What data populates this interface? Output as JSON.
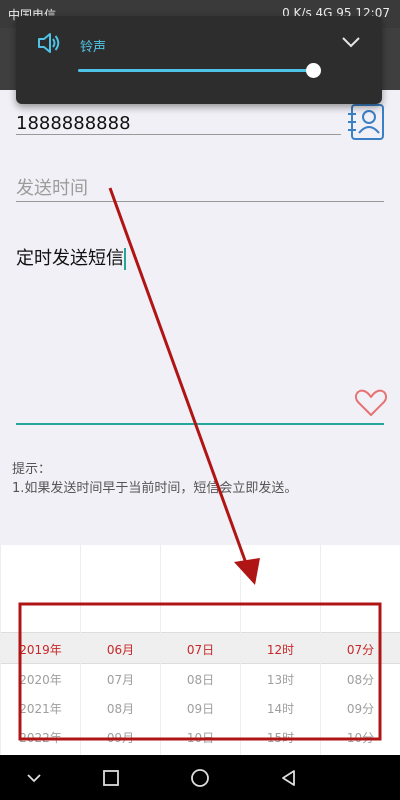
{
  "status_bar": {
    "carrier": "中国电信",
    "speed": "0 K/s",
    "network": "4G",
    "battery": "95",
    "time": "12:07"
  },
  "volume_popup": {
    "label": "铃声",
    "level": 0.97,
    "accent_color": "#4fc3e6"
  },
  "form": {
    "phone_value": "1888888888",
    "send_time_placeholder": "发送时间",
    "message_value": "定时发送短信"
  },
  "tips": {
    "title": "提示：",
    "line1": "1.如果发送时间早于当前时间，短信会立即发送。"
  },
  "picker": {
    "highlight_color": "#c62828",
    "columns": [
      {
        "selected": "2019年",
        "items": [
          "2020年",
          "2021年",
          "2022年"
        ]
      },
      {
        "selected": "06月",
        "items": [
          "07月",
          "08月",
          "09月"
        ]
      },
      {
        "selected": "07日",
        "items": [
          "08日",
          "09日",
          "10日"
        ]
      },
      {
        "selected": "12时",
        "items": [
          "13时",
          "14时",
          "15时"
        ]
      },
      {
        "selected": "07分",
        "items": [
          "08分",
          "09分",
          "10分"
        ]
      }
    ]
  },
  "annotation_color": "#b01515",
  "icons": {
    "speaker": "speaker-icon",
    "chevron": "chevron-down-icon",
    "contact": "contact-book-icon",
    "heart": "heart-icon",
    "nav_back": "nav-back-icon",
    "nav_home": "nav-home-icon",
    "nav_recents": "nav-recents-icon",
    "nav_down": "nav-down-icon"
  }
}
